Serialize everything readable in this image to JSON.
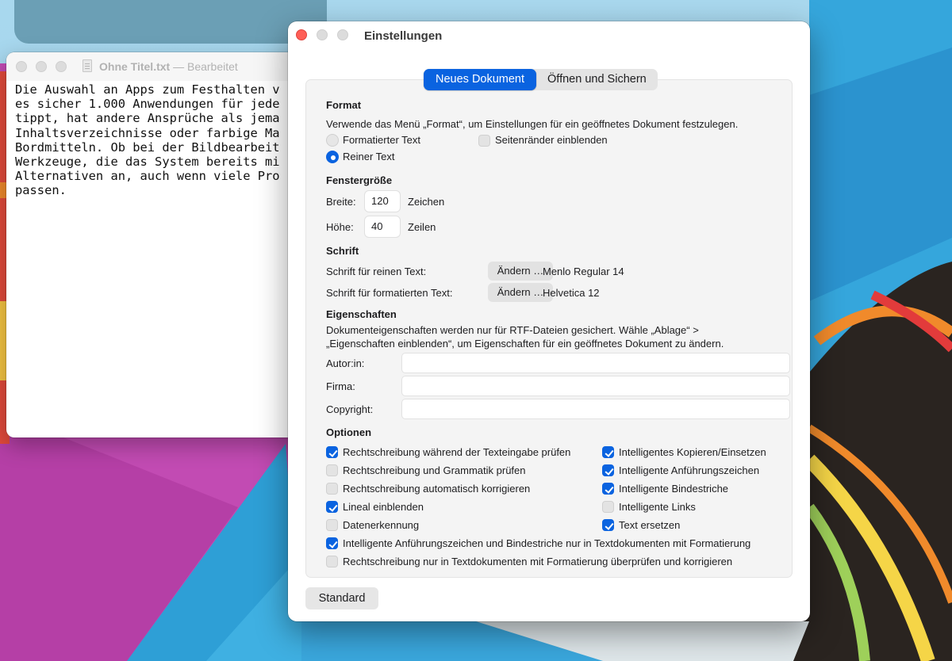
{
  "editor": {
    "document_name": "Ohne Titel.txt",
    "title_separator": "—",
    "status": "Bearbeitet",
    "lines": [
      "Die Auswahl an Apps zum Festhalten v",
      "es sicher 1.000 Anwendungen für jede",
      "tippt, hat andere Ansprüche als jema",
      "Inhaltsverzeichnisse oder farbige Ma",
      "Bordmitteln. Ob bei der Bildbearbeit",
      "Werkzeuge, die das System bereits mi",
      "Alternativen an, auch wenn viele Pro",
      "passen."
    ]
  },
  "settings": {
    "title": "Einstellungen",
    "tabs": [
      {
        "label": "Neues Dokument",
        "active": true
      },
      {
        "label": "Öffnen und Sichern",
        "active": false
      }
    ],
    "format": {
      "title": "Format",
      "description": "Verwende das Menü „Format“, um Einstellungen für ein geöffnetes Dokument festzulegen.",
      "rich_text_label": "Formatierter Text",
      "plain_text_label": "Reiner Text",
      "selected": "Reiner Text",
      "show_margins_label": "Seitenränder einblenden",
      "show_margins_checked": false
    },
    "window_size": {
      "title": "Fenstergröße",
      "width_label": "Breite:",
      "width_value": "120",
      "width_unit": "Zeichen",
      "height_label": "Höhe:",
      "height_value": "40",
      "height_unit": "Zeilen"
    },
    "font": {
      "title": "Schrift",
      "plain_label": "Schrift für reinen Text:",
      "plain_button": "Ändern …",
      "plain_font": "Menlo Regular 14",
      "rich_label": "Schrift für formatierten Text:",
      "rich_button": "Ändern …",
      "rich_font": "Helvetica 12"
    },
    "properties": {
      "title": "Eigenschaften",
      "description_line1": "Dokumenteigenschaften werden nur für RTF-Dateien gesichert. Wähle „Ablage“ >",
      "description_line2": "„Eigenschaften einblenden“, um Eigenschaften für ein geöffnetes Dokument zu ändern.",
      "author_label": "Autor:in:",
      "author_value": "",
      "company_label": "Firma:",
      "company_value": "",
      "copyright_label": "Copyright:",
      "copyright_value": ""
    },
    "options": {
      "title": "Optionen",
      "left": [
        {
          "label": "Rechtschreibung während der Texteingabe prüfen",
          "checked": true
        },
        {
          "label": "Rechtschreibung und Grammatik prüfen",
          "checked": false
        },
        {
          "label": "Rechtschreibung automatisch korrigieren",
          "checked": false
        },
        {
          "label": "Lineal einblenden",
          "checked": true
        },
        {
          "label": "Datenerkennung",
          "checked": false
        }
      ],
      "right": [
        {
          "label": "Intelligentes Kopieren/Einsetzen",
          "checked": true
        },
        {
          "label": "Intelligente Anführungszeichen",
          "checked": true
        },
        {
          "label": "Intelligente Bindestriche",
          "checked": true
        },
        {
          "label": "Intelligente Links",
          "checked": false
        },
        {
          "label": "Text ersetzen",
          "checked": true
        }
      ],
      "full": [
        {
          "label": "Intelligente Anführungszeichen und Bindestriche nur in Textdokumenten mit Formatierung",
          "checked": true
        },
        {
          "label": "Rechtschreibung nur in Textdokumenten mit Formatierung überprüfen und korrigieren",
          "checked": false
        }
      ]
    },
    "restore_defaults_label": "Standard"
  },
  "colors": {
    "accent": "#0a63e0",
    "close_button": "#ff5f57",
    "panel_background": "#f4f4f4"
  }
}
